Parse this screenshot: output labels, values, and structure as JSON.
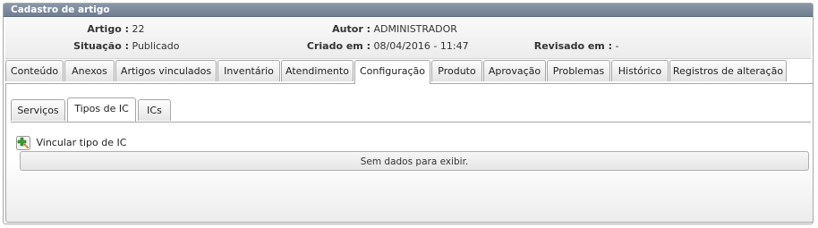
{
  "panel": {
    "title": "Cadastro de artigo"
  },
  "info": {
    "artigo_label": "Artigo :",
    "artigo_value": "22",
    "autor_label": "Autor :",
    "autor_value": "ADMINISTRADOR",
    "situacao_label": "Situação :",
    "situacao_value": "Publicado",
    "criado_label": "Criado em :",
    "criado_value": "08/04/2016 - 11:47",
    "revisado_label": "Revisado em :",
    "revisado_value": "-"
  },
  "tabs": [
    {
      "label": "Conteúdo"
    },
    {
      "label": "Anexos"
    },
    {
      "label": "Artigos vinculados"
    },
    {
      "label": "Inventário"
    },
    {
      "label": "Atendimento"
    },
    {
      "label": "Configuração"
    },
    {
      "label": "Produto"
    },
    {
      "label": "Aprovação"
    },
    {
      "label": "Problemas"
    },
    {
      "label": "Histórico"
    },
    {
      "label": "Registros de alteração"
    }
  ],
  "active_tab": "Configuração",
  "subtabs": [
    {
      "label": "Serviços"
    },
    {
      "label": "Tipos de IC"
    },
    {
      "label": "ICs"
    }
  ],
  "active_subtab": "Tipos de IC",
  "add_link": {
    "label": "Vincular tipo de IC",
    "icon": "add-link-icon"
  },
  "empty_message": "Sem dados para exibir.",
  "colors": {
    "header": "#7b889b",
    "border": "#a7a7a7",
    "icon_green": "#3c9b2f",
    "icon_orange": "#e59a2a"
  }
}
